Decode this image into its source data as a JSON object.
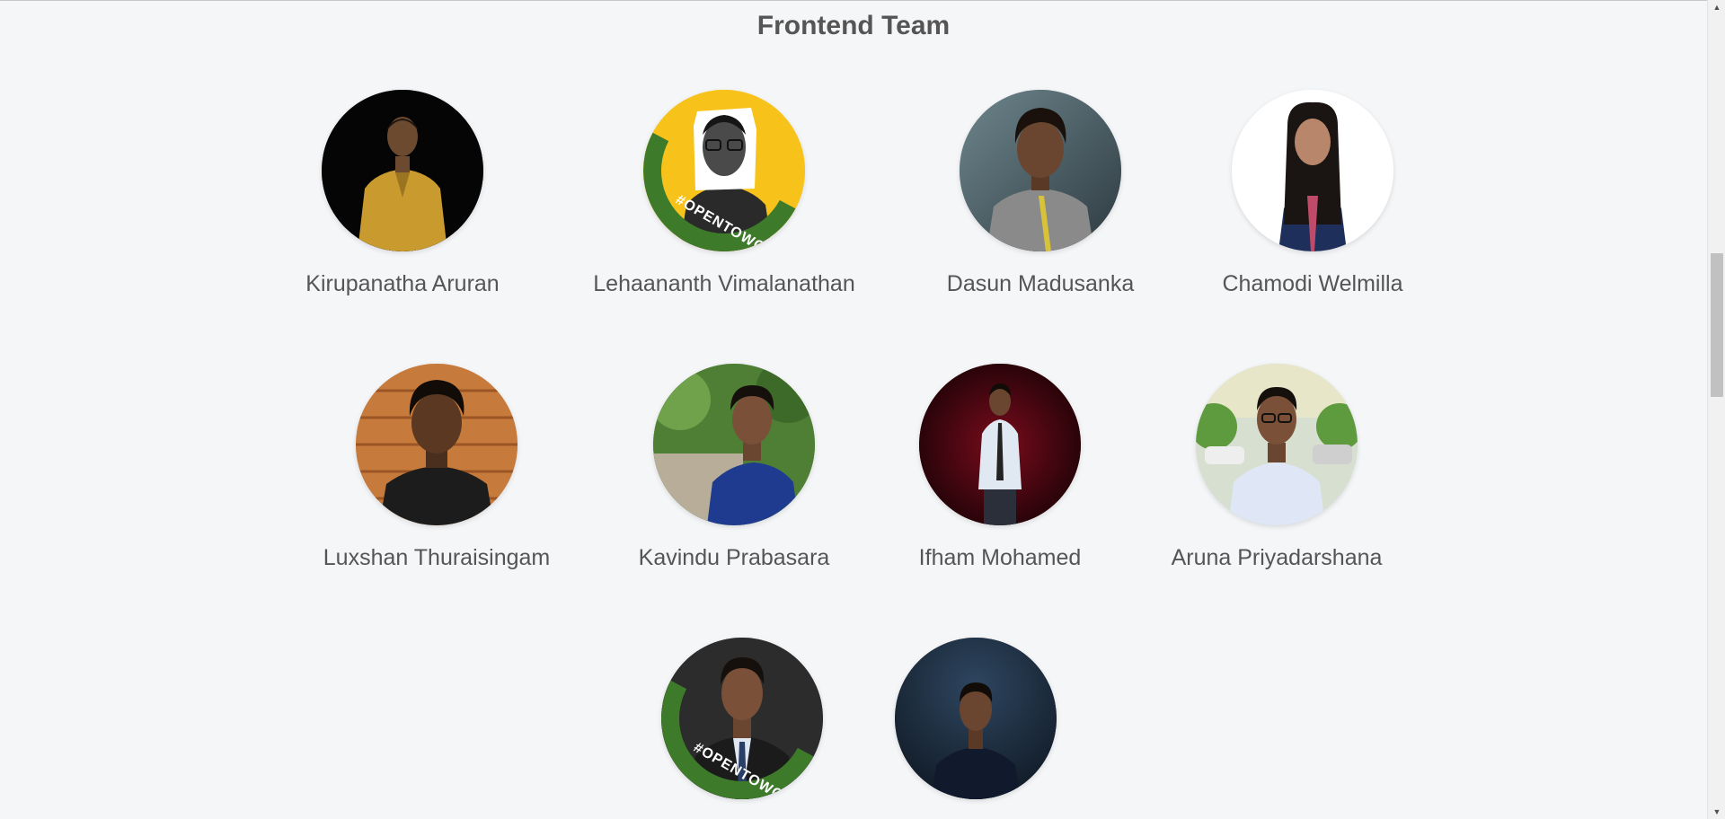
{
  "section": {
    "title": "Frontend Team"
  },
  "members": [
    {
      "name": "Kirupanatha Aruran",
      "badge": ""
    },
    {
      "name": "Lehaananth Vimalanathan",
      "badge": "#OPENTOWORK"
    },
    {
      "name": "Dasun Madusanka",
      "badge": ""
    },
    {
      "name": "Chamodi Welmilla",
      "badge": ""
    },
    {
      "name": "Luxshan Thuraisingam",
      "badge": ""
    },
    {
      "name": "Kavindu Prabasara",
      "badge": ""
    },
    {
      "name": "Ifham Mohamed",
      "badge": ""
    },
    {
      "name": "Aruna Priyadarshana",
      "badge": ""
    },
    {
      "name": "",
      "badge": "#OPENTOWORK"
    },
    {
      "name": "",
      "badge": ""
    }
  ],
  "colors": {
    "background": "#f5f6f8",
    "title": "#555555",
    "name": "#555555",
    "opentowork_green": "#3d7a2a",
    "yellow_bg": "#f7c31a"
  },
  "scrollbar": {
    "up_icon": "triangle-up-icon",
    "down_icon": "triangle-down-icon"
  }
}
